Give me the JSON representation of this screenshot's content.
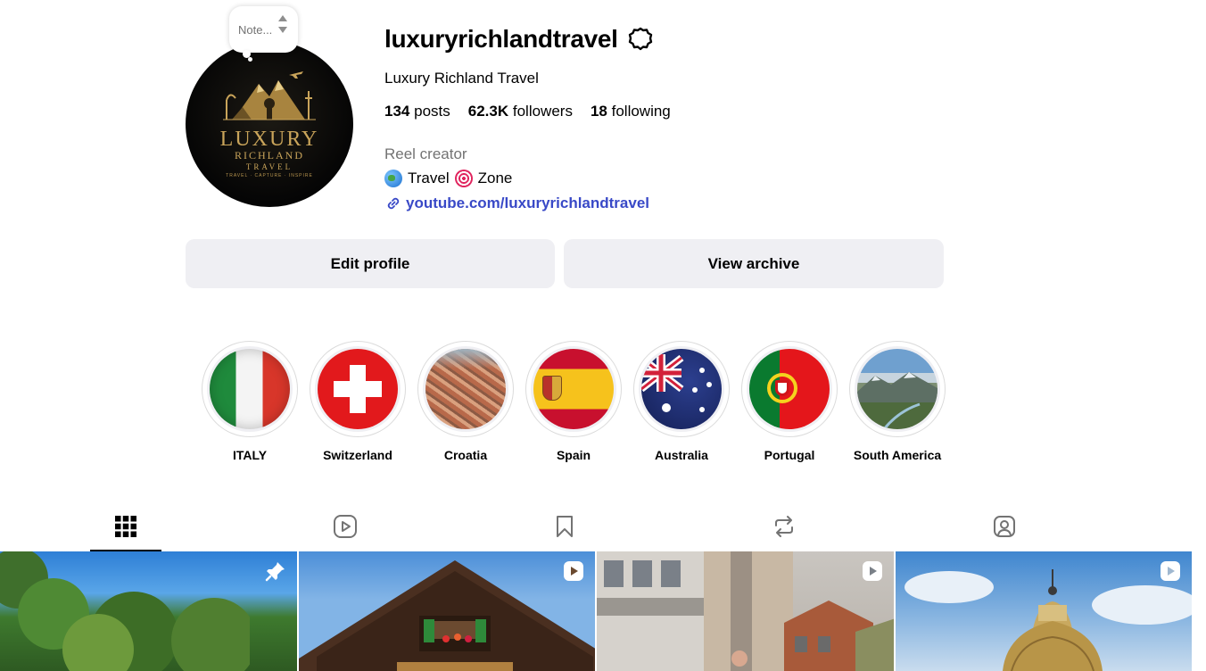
{
  "profile": {
    "note": "Note...",
    "username": "luxuryrichlandtravel",
    "full_name": "Luxury Richland Travel",
    "stats": {
      "posts_count": "134",
      "posts_label": "posts",
      "followers_count": "62.3K",
      "followers_label": "followers",
      "following_count": "18",
      "following_label": "following"
    },
    "category": "Reel creator",
    "bio": {
      "word1": "Travel",
      "word2": "Zone"
    },
    "link": "youtube.com/luxuryrichlandtravel",
    "avatar": {
      "main": "LUXURY",
      "sub": "RICHLAND",
      "sub2": "TRAVEL",
      "tagline": "TRAVEL · CAPTURE · INSPIRE"
    }
  },
  "actions": {
    "edit_label": "Edit profile",
    "archive_label": "View archive"
  },
  "highlights": [
    {
      "label": "ITALY",
      "image": "italy-flag"
    },
    {
      "label": "Switzerland",
      "image": "switzerland-flag"
    },
    {
      "label": "Croatia",
      "image": "croatia-city-aerial"
    },
    {
      "label": "Spain",
      "image": "spain-flag"
    },
    {
      "label": "Australia",
      "image": "australia-flag"
    },
    {
      "label": "Portugal",
      "image": "portugal-flag"
    },
    {
      "label": "South America",
      "image": "mountain-valley"
    }
  ],
  "tabs": [
    {
      "icon": "grid-icon",
      "active": true
    },
    {
      "icon": "reels-icon",
      "active": false
    },
    {
      "icon": "saved-icon",
      "active": false
    },
    {
      "icon": "reposts-icon",
      "active": false
    },
    {
      "icon": "tagged-icon",
      "active": false
    }
  ],
  "posts": [
    {
      "badge": "pin-icon",
      "scene": "trees-sky"
    },
    {
      "badge": "reel-icon",
      "scene": "chalet"
    },
    {
      "badge": "reel-icon",
      "scene": "town-street"
    },
    {
      "badge": "reel-icon",
      "scene": "dome-tower"
    }
  ],
  "colors": {
    "link": "#3949c7",
    "button_bg": "#efeff3",
    "muted_text": "#737373",
    "avatar_gold": "#c9a45a"
  }
}
